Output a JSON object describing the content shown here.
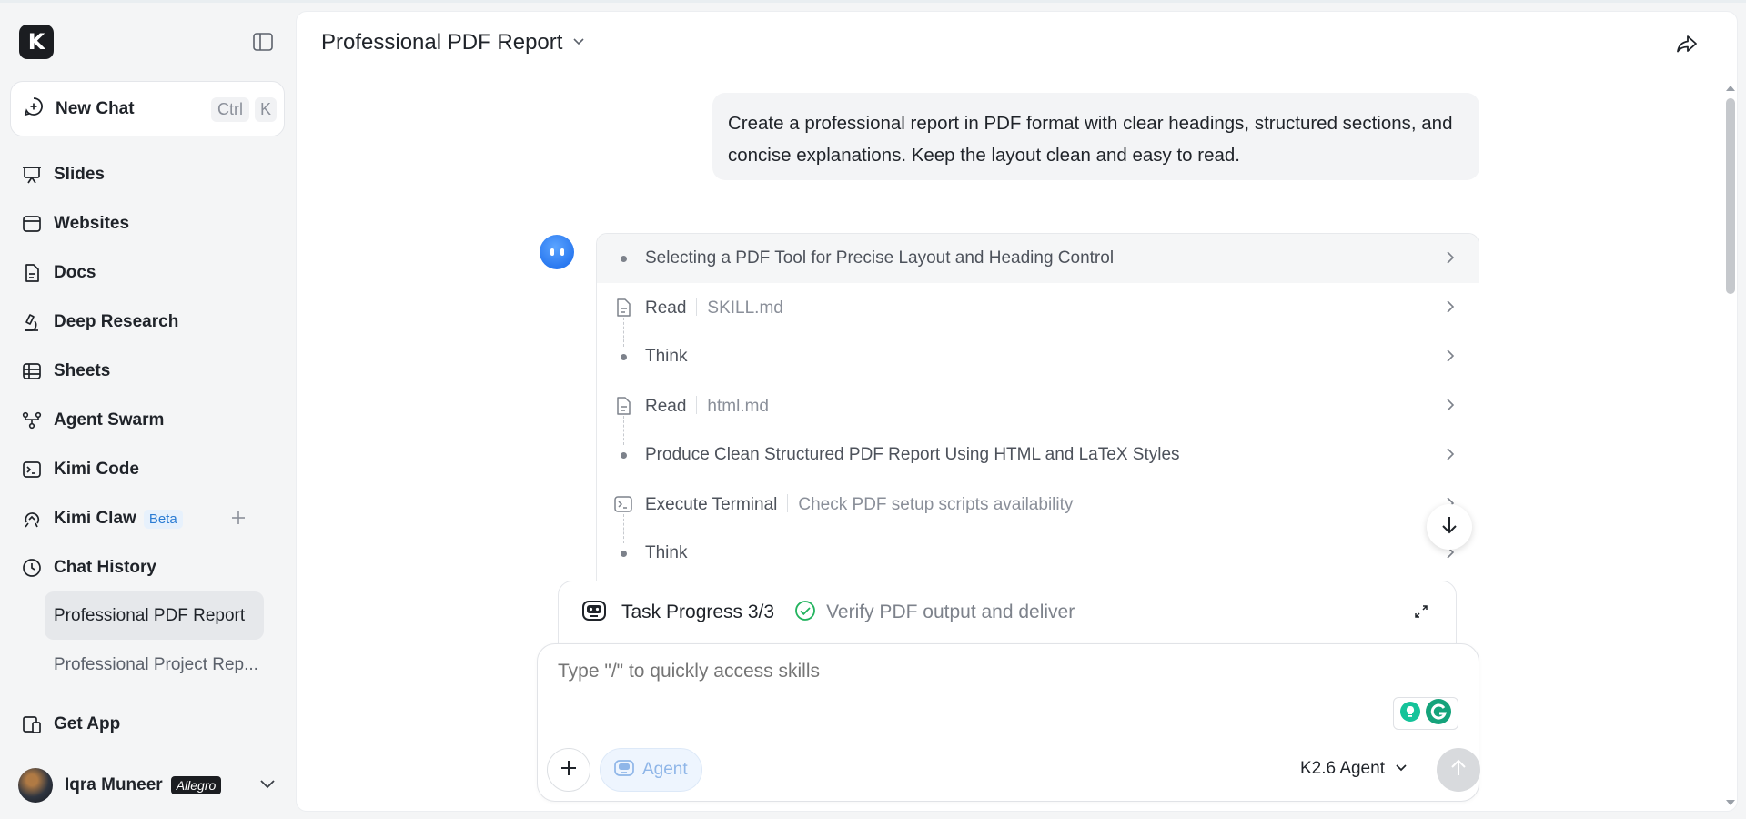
{
  "sidebar": {
    "logo_letter": "K",
    "new_chat": {
      "label": "New Chat",
      "shortcut_ctrl": "Ctrl",
      "shortcut_key": "K"
    },
    "nav": [
      {
        "label": "Slides",
        "icon": "presentation-icon"
      },
      {
        "label": "Websites",
        "icon": "browser-window-icon"
      },
      {
        "label": "Docs",
        "icon": "document-icon"
      },
      {
        "label": "Deep Research",
        "icon": "microscope-icon"
      },
      {
        "label": "Sheets",
        "icon": "table-icon"
      },
      {
        "label": "Agent Swarm",
        "icon": "swarm-icon"
      },
      {
        "label": "Kimi Code",
        "icon": "terminal-icon"
      },
      {
        "label": "Kimi Claw",
        "icon": "claw-icon",
        "badge": "Beta"
      },
      {
        "label": "Chat History",
        "icon": "clock-icon"
      }
    ],
    "history": [
      {
        "label": "Professional PDF Report",
        "active": true
      },
      {
        "label": "Professional Project Rep...",
        "active": false
      }
    ],
    "get_app": {
      "label": "Get App",
      "icon": "devices-icon"
    },
    "user": {
      "name": "Iqra Muneer",
      "plan": "Allegro"
    }
  },
  "header": {
    "title": "Professional PDF Report"
  },
  "conversation": {
    "user_message": "Create a professional report in PDF format with clear headings, structured sections, and concise explanations. Keep the layout clean and easy to read.",
    "steps": [
      {
        "type": "dot",
        "label": "Selecting a PDF Tool for Precise Layout and Heading Control",
        "arg": ""
      },
      {
        "type": "file",
        "label": "Read",
        "arg": "SKILL.md"
      },
      {
        "type": "dot",
        "label": "Think",
        "arg": ""
      },
      {
        "type": "file",
        "label": "Read",
        "arg": "html.md"
      },
      {
        "type": "dot",
        "label": "Produce Clean Structured PDF Report Using HTML and LaTeX Styles",
        "arg": ""
      },
      {
        "type": "terminal",
        "label": "Execute Terminal",
        "arg": "Check PDF setup scripts availability"
      },
      {
        "type": "dot",
        "label": "Think",
        "arg": ""
      }
    ]
  },
  "task_progress": {
    "title": "Task Progress 3/3",
    "status": "Verify PDF output and deliver"
  },
  "composer": {
    "placeholder": "Type \"/\" to quickly access skills",
    "agent_label": "Agent",
    "model": "K2.6 Agent"
  },
  "colors": {
    "accent": "#2a79f0",
    "success": "#22b35e",
    "grammarly": "#15c39a"
  }
}
